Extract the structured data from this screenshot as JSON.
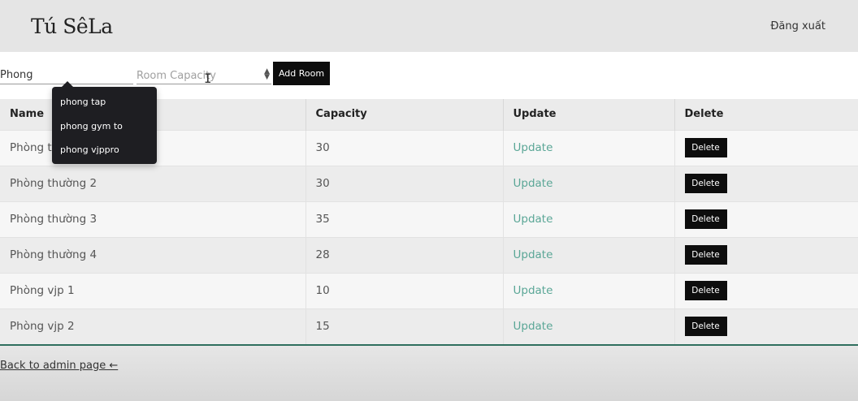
{
  "header": {
    "logo": "Tú SêLa",
    "logout_label": "Đăng xuất"
  },
  "form": {
    "name_value": "Phong",
    "capacity_placeholder": "Room Capacity",
    "add_button_label": "Add Room"
  },
  "autocomplete": [
    "phong tap",
    "phong gym to",
    "phong vjppro"
  ],
  "table": {
    "columns": [
      "Name",
      "Capacity",
      "Update",
      "Delete"
    ],
    "rows": [
      {
        "name": "Phòng thường 1",
        "capacity": "30",
        "update": "Update",
        "delete": "Delete"
      },
      {
        "name": "Phòng thường 2",
        "capacity": "30",
        "update": "Update",
        "delete": "Delete"
      },
      {
        "name": "Phòng thường 3",
        "capacity": "35",
        "update": "Update",
        "delete": "Delete"
      },
      {
        "name": "Phòng thường 4",
        "capacity": "28",
        "update": "Update",
        "delete": "Delete"
      },
      {
        "name": "Phòng vjp 1",
        "capacity": "10",
        "update": "Update",
        "delete": "Delete"
      },
      {
        "name": "Phòng vjp 2",
        "capacity": "15",
        "update": "Update",
        "delete": "Delete"
      }
    ]
  },
  "footer": {
    "back_link": "Back to admin page ←"
  },
  "colors": {
    "accent_update": "#5aa696",
    "button_bg": "#0d0d0d",
    "table_bottom_border": "#2f6f5e"
  }
}
